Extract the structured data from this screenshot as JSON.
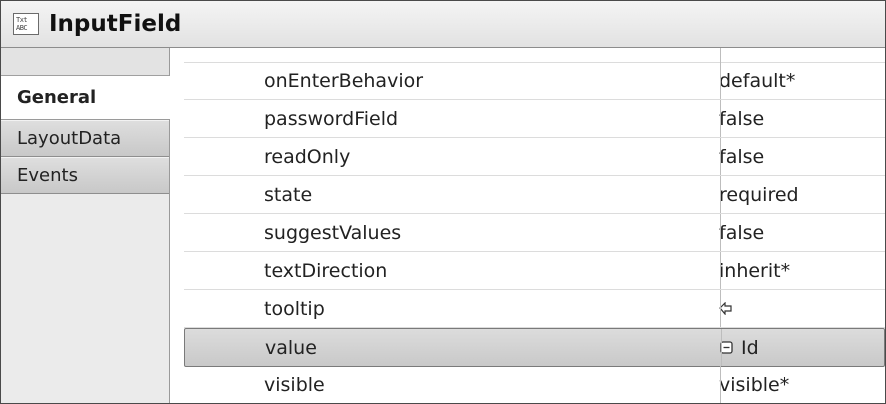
{
  "header": {
    "title": "InputField",
    "icon": "text-field-icon",
    "icon_text": "Txt ABC"
  },
  "tabs": [
    {
      "label": "General",
      "active": true
    },
    {
      "label": "LayoutData",
      "active": false
    },
    {
      "label": "Events",
      "active": false
    }
  ],
  "properties": [
    {
      "name": "onEnterBehavior",
      "value": "default*"
    },
    {
      "name": "passwordField",
      "value": "false"
    },
    {
      "name": "readOnly",
      "value": "false"
    },
    {
      "name": "state",
      "value": "required"
    },
    {
      "name": "suggestValues",
      "value": "false"
    },
    {
      "name": "textDirection",
      "value": "inherit*"
    },
    {
      "name": "tooltip",
      "value": "",
      "value_icon": "binding-arrow-icon"
    },
    {
      "name": "value",
      "value": "Id",
      "value_icon": "context-attribute-icon",
      "selected": true
    },
    {
      "name": "visible",
      "value": "visible*"
    }
  ],
  "colors": {
    "selected_row": "#d2d2d2",
    "tab_background": "#d4d4d4",
    "header_background": "#ebebeb"
  }
}
